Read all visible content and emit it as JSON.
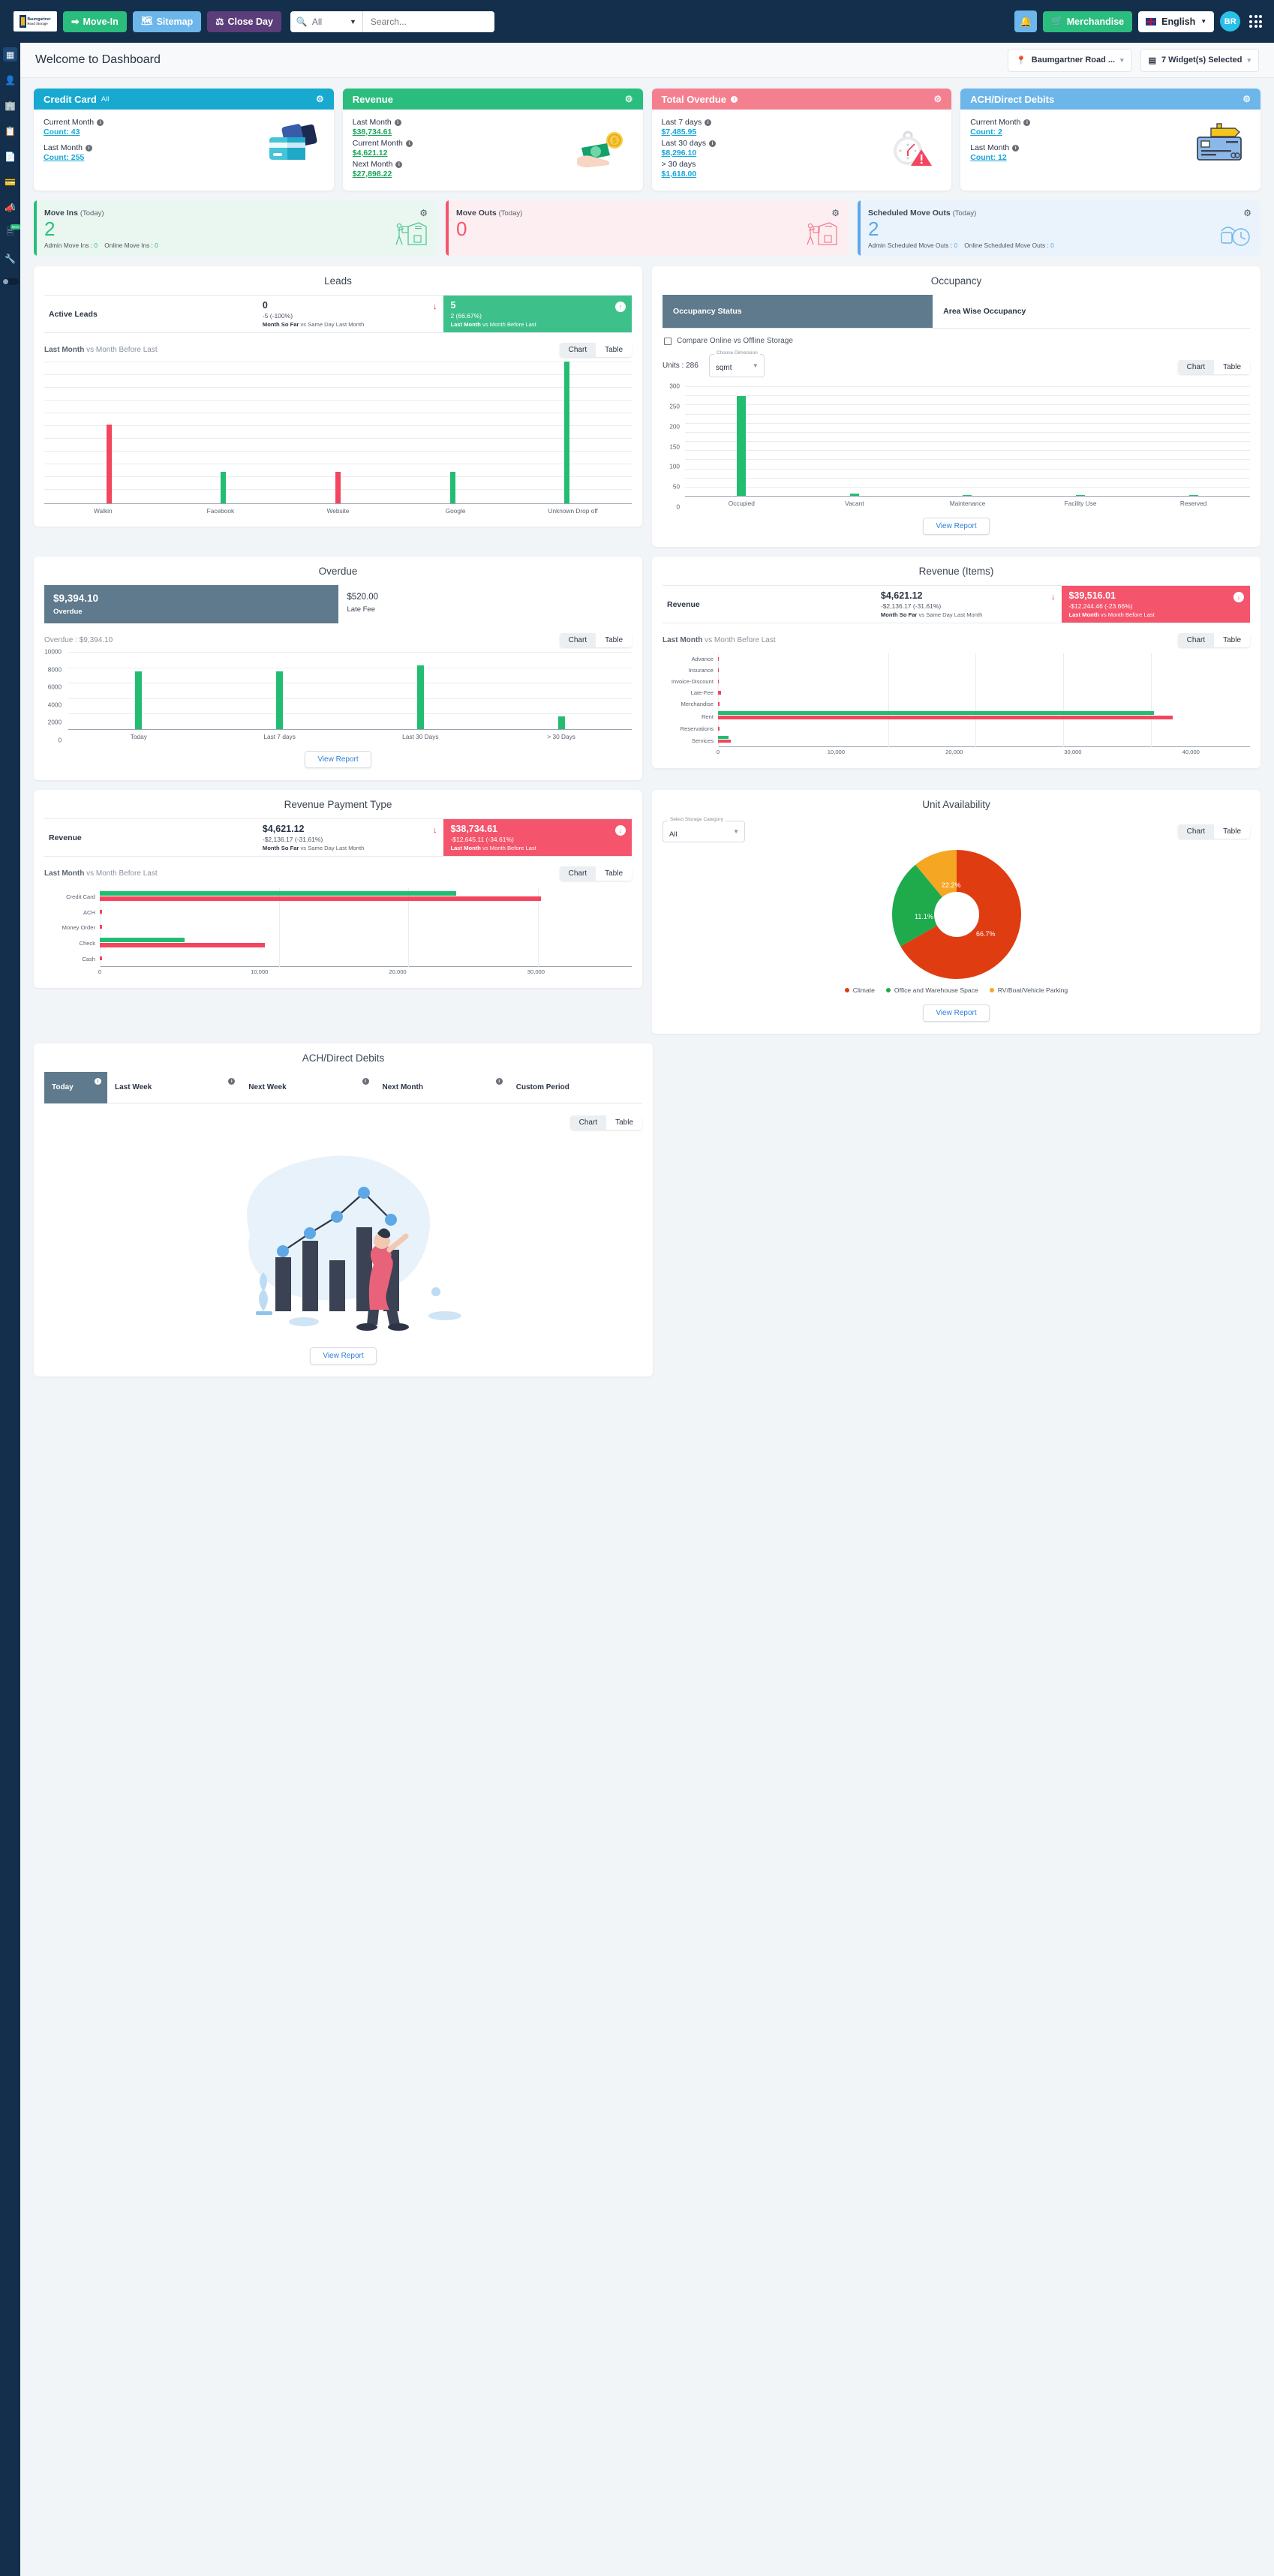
{
  "topbar": {
    "logo_line1": "Baumgartner",
    "logo_line2": "Road Storage",
    "move_in": "Move-In",
    "sitemap": "Sitemap",
    "close_day": "Close Day",
    "search_scope": "All",
    "search_placeholder": "Search...",
    "merchandise": "Merchandise",
    "language": "English",
    "avatar_initials": "BR"
  },
  "page": {
    "title": "Welcome to Dashboard",
    "facility_select": "Baumgartner Road ...",
    "widget_select": "7 Widget(s) Selected"
  },
  "kpi_cards": [
    {
      "title": "Credit Card",
      "subtitle": "All",
      "color": "#17a9cf",
      "art": "credit-card",
      "rows": [
        {
          "label": "Current Month",
          "value": "Count: 43",
          "color": "cyan",
          "info": true
        },
        {
          "label": "Last Month",
          "value": "Count: 255",
          "color": "cyan",
          "info": true
        }
      ]
    },
    {
      "title": "Revenue",
      "subtitle": "",
      "color": "#2bbd7e",
      "art": "money",
      "rows": [
        {
          "label": "Last Month",
          "value": "$38,734.61",
          "color": "green",
          "info": true
        },
        {
          "label": "Current Month",
          "value": "$4,621.12",
          "color": "green",
          "info": true
        },
        {
          "label": "Next Month",
          "value": "$27,898.22",
          "color": "green",
          "info": true
        }
      ]
    },
    {
      "title": "Total Overdue",
      "subtitle": "",
      "color": "#f4808f",
      "art": "clock",
      "title_info": true,
      "rows": [
        {
          "label": "Last 7 days",
          "value": "$7,485.95",
          "color": "cyan",
          "info": true
        },
        {
          "label": "Last 30 days",
          "value": "$8,296.10",
          "color": "cyan",
          "info": true
        },
        {
          "label": "> 30 days",
          "value": "$1,618.00",
          "color": "cyan",
          "info": false
        }
      ]
    },
    {
      "title": "ACH/Direct Debits",
      "subtitle": "",
      "color": "#6cb6ea",
      "art": "debit-card",
      "rows": [
        {
          "label": "Current Month",
          "value": "Count: 2",
          "color": "cyan",
          "info": true
        },
        {
          "label": "Last Month",
          "value": "Count: 12",
          "color": "cyan",
          "info": true
        }
      ]
    }
  ],
  "move_cards": [
    {
      "title": "Move Ins",
      "period": "(Today)",
      "value": "2",
      "tone": "green",
      "detail_a_label": "Admin Move Ins :",
      "detail_a_value": "0",
      "detail_b_label": "Online Move Ins :",
      "detail_b_value": "0",
      "art": "mover-warehouse"
    },
    {
      "title": "Move Outs",
      "period": "(Today)",
      "value": "0",
      "tone": "red",
      "detail_a_label": "",
      "detail_a_value": "",
      "detail_b_label": "",
      "detail_b_value": "",
      "art": "mover-out"
    },
    {
      "title": "Scheduled Move Outs",
      "period": "(Today)",
      "value": "2",
      "tone": "blue",
      "detail_a_label": "Admin Scheduled Move Outs :",
      "detail_a_value": "0",
      "detail_b_label": "Online Scheduled Move Outs :",
      "detail_b_value": "0",
      "art": "calendar-clock"
    }
  ],
  "widgets": {
    "leads": {
      "title": "Leads",
      "row_label": "Active Leads",
      "current": {
        "num": "0",
        "delta": "-5 (-100%)",
        "note_bold": "Month So Far",
        "note_rest": " vs Same Day Last Month"
      },
      "last": {
        "num": "5",
        "delta": "2 (66.67%)",
        "note_bold": "Last Month",
        "note_rest": " vs Month Before Last"
      },
      "sub_bold": "Last Month",
      "sub_rest": " vs Month Before Last",
      "toggle": {
        "chart": "Chart",
        "table": "Table",
        "active": "Chart"
      }
    },
    "occupancy": {
      "title": "Occupancy",
      "tab_status": "Occupancy Status",
      "tab_area": "Area Wise Occupancy",
      "compare_label": "Compare Online vs Offline Storage",
      "units_label": "Units : 286",
      "dimension_float": "Choose Dimension",
      "dimension_value": "sqmt",
      "toggle": {
        "chart": "Chart",
        "table": "Table",
        "active": "Chart"
      },
      "view_report": "View Report"
    },
    "overdue": {
      "title": "Overdue",
      "amount": "$9,394.10",
      "amount_label": "Overdue",
      "late_fee": "$520.00",
      "late_fee_label": "Late Fee",
      "sub_label": "Overdue : $9,394.10",
      "toggle": {
        "chart": "Chart",
        "table": "Table",
        "active": "Chart"
      },
      "view_report": "View Report"
    },
    "revenue_items": {
      "title": "Revenue (Items)",
      "row_label": "Revenue",
      "current": {
        "num": "$4,621.12",
        "delta": "-$2,136.17 (-31.61%)",
        "note_bold": "Month So Far",
        "note_rest": " vs Same Day Last Month"
      },
      "last": {
        "num": "$39,516.01",
        "delta": "-$12,244.46 (-23.66%)",
        "note_bold": "Last Month",
        "note_rest": " vs Month Before Last"
      },
      "sub_bold": "Last Month",
      "sub_rest": " vs Month Before Last",
      "toggle": {
        "chart": "Chart",
        "table": "Table",
        "active": "Chart"
      }
    },
    "revenue_payment_type": {
      "title": "Revenue Payment Type",
      "row_label": "Revenue",
      "current": {
        "num": "$4,621.12",
        "delta": "-$2,136.17 (-31.61%)",
        "note_bold": "Month So Far",
        "note_rest": " vs Same Day Last Month"
      },
      "last": {
        "num": "$38,734.61",
        "delta": "-$12,645.11 (-34.61%)",
        "note_bold": "Last Month",
        "note_rest": " vs Month Before Last"
      },
      "sub_bold": "Last Month",
      "sub_rest": " vs Month Before Last",
      "toggle": {
        "chart": "Chart",
        "table": "Table",
        "active": "Chart"
      }
    },
    "unit_availability": {
      "title": "Unit Availability",
      "category_float": "Select Storage Category",
      "category_value": "All",
      "toggle": {
        "chart": "Chart",
        "table": "Table",
        "active": "Chart"
      },
      "view_report": "View Report"
    },
    "ach": {
      "title": "ACH/Direct Debits",
      "periods": [
        "Today",
        "Last Week",
        "Next Week",
        "Next Month",
        "Custom Period"
      ],
      "active_period": "Today",
      "toggle": {
        "chart": "Chart",
        "table": "Table",
        "active": "Chart"
      },
      "view_report": "View Report"
    }
  },
  "chart_data": [
    {
      "type": "bar",
      "id": "leads",
      "title": "Leads",
      "categories": [
        "Walkin",
        "Facebook",
        "Website",
        "Google",
        "Unknown Drop off"
      ],
      "values": [
        5,
        2,
        2,
        2,
        9
      ],
      "colors": [
        "#f4455f",
        "#23bd72",
        "#f4455f",
        "#23bd72",
        "#23bd72"
      ],
      "ylim": [
        0,
        9
      ],
      "grid": true,
      "xlabel": "",
      "ylabel": ""
    },
    {
      "type": "bar",
      "id": "occupancy",
      "title": "Occupancy Status",
      "categories": [
        "Occupied",
        "Vacant",
        "Maintenance",
        "Facility Use",
        "Reserved"
      ],
      "values": [
        274,
        7,
        1,
        2,
        1
      ],
      "tick_labels": [
        "0",
        "50",
        "100",
        "150",
        "200",
        "250",
        "300"
      ],
      "ylim": [
        0,
        300
      ],
      "series_color": "#2bbd7e",
      "grid": true,
      "xlabel": "",
      "ylabel": ""
    },
    {
      "type": "bar",
      "id": "overdue",
      "title": "Overdue : $9,394.10",
      "categories": [
        "Today",
        "Last 7 days",
        "Last 30 Days",
        "> 30 Days"
      ],
      "values": [
        7485,
        7485,
        8296,
        1618
      ],
      "tick_labels": [
        "0",
        "2000",
        "4000",
        "6000",
        "8000",
        "10000"
      ],
      "ylim": [
        0,
        10000
      ],
      "series_color": "#23bd72",
      "grid": true,
      "xlabel": "",
      "ylabel": ""
    },
    {
      "type": "bar",
      "id": "revenue_items",
      "orientation": "horizontal",
      "title": "Revenue (Items)",
      "categories": [
        "Advance",
        "Insurance",
        "Invoice-Discount",
        "Late-Fee",
        "Merchandise",
        "Rent",
        "Reservations",
        "Services"
      ],
      "series": [
        {
          "name": "Last Month",
          "values": [
            0,
            0,
            0,
            0,
            0,
            38500,
            0,
            900
          ],
          "color": "#f4455f"
        },
        {
          "name": "Month Before Last",
          "values": [
            0,
            0,
            0,
            0,
            0,
            37000,
            0,
            700
          ],
          "color": "#23bd72"
        }
      ],
      "tick_labels": [
        "0",
        "10,000",
        "20,000",
        "30,000",
        "40,000"
      ],
      "xlim": [
        0,
        45000
      ],
      "grid": true
    },
    {
      "type": "bar",
      "id": "revenue_payment_type",
      "orientation": "horizontal",
      "title": "Revenue Payment Type",
      "categories": [
        "Credit Card",
        "ACH",
        "Money Order",
        "Check",
        "Cash"
      ],
      "series": [
        {
          "name": "Last Month",
          "values": [
            28500,
            0,
            0,
            10500,
            0
          ],
          "color": "#f4455f"
        },
        {
          "name": "Month Before Last",
          "values": [
            23000,
            0,
            0,
            5500,
            0
          ],
          "color": "#23bd72"
        }
      ],
      "tick_labels": [
        "0",
        "10,000",
        "20,000",
        "30,000"
      ],
      "xlim": [
        0,
        33000
      ],
      "grid": true
    },
    {
      "type": "pie",
      "id": "unit_availability",
      "title": "Unit Availability",
      "labels": [
        "Climate",
        "Office and Warehouse Space",
        "RV/Boat/Vehicle Parking"
      ],
      "values": [
        66.7,
        22.2,
        11.1
      ],
      "display_values": [
        "66.7%",
        "22.2%",
        "11.1%"
      ],
      "colors": [
        "#e03c12",
        "#1faa4b",
        "#f5a623"
      ],
      "legend_position": "bottom",
      "donut": true
    }
  ]
}
